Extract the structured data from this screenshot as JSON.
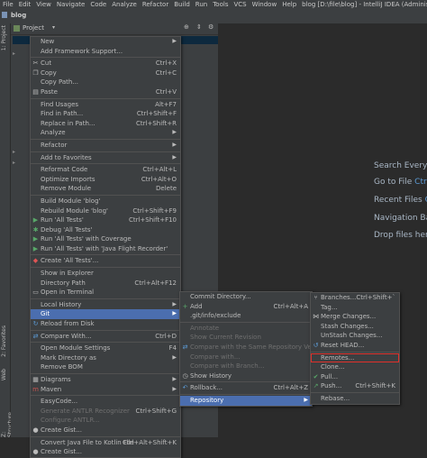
{
  "menubar": [
    "File",
    "Edit",
    "View",
    "Navigate",
    "Code",
    "Analyze",
    "Refactor",
    "Build",
    "Run",
    "Tools",
    "VCS",
    "Window",
    "Help",
    "blog [D:\\file\\blog] - IntelliJ IDEA (Administrator)"
  ],
  "breadcrumb": "blog",
  "project_panel": {
    "title": "Project"
  },
  "side_tabs": {
    "project": "1: Project",
    "favorites": "2: Favorites",
    "web": "Web",
    "structure": "Z: Structure"
  },
  "editor_hints": [
    {
      "label": "Search Everywh",
      "key": ""
    },
    {
      "label": "Go to File ",
      "key": "Ctrl+"
    },
    {
      "label": "Recent Files ",
      "key": "Ct"
    },
    {
      "label": "Navigation Bar ",
      "key": ""
    },
    {
      "label": "Drop files here",
      "key": ""
    }
  ],
  "context_menu": [
    {
      "label": "New",
      "arrow": true
    },
    {
      "label": "Add Framework Support..."
    },
    {
      "sep": true
    },
    {
      "label": "Cut",
      "shortcut": "Ctrl+X",
      "icon": "cut-icon"
    },
    {
      "label": "Copy",
      "shortcut": "Ctrl+C",
      "icon": "copy-icon"
    },
    {
      "label": "Copy Path..."
    },
    {
      "label": "Paste",
      "shortcut": "Ctrl+V",
      "icon": "paste-icon"
    },
    {
      "sep": true
    },
    {
      "label": "Find Usages",
      "shortcut": "Alt+F7"
    },
    {
      "label": "Find in Path...",
      "shortcut": "Ctrl+Shift+F"
    },
    {
      "label": "Replace in Path...",
      "shortcut": "Ctrl+Shift+R"
    },
    {
      "label": "Analyze",
      "arrow": true
    },
    {
      "sep": true
    },
    {
      "label": "Refactor",
      "arrow": true
    },
    {
      "sep": true
    },
    {
      "label": "Add to Favorites",
      "arrow": true
    },
    {
      "sep": true
    },
    {
      "label": "Reformat Code",
      "shortcut": "Ctrl+Alt+L"
    },
    {
      "label": "Optimize Imports",
      "shortcut": "Ctrl+Alt+O"
    },
    {
      "label": "Remove Module",
      "shortcut": "Delete"
    },
    {
      "sep": true
    },
    {
      "label": "Build Module 'blog'"
    },
    {
      "label": "Rebuild Module 'blog'",
      "shortcut": "Ctrl+Shift+F9"
    },
    {
      "label": "Run 'All Tests'",
      "shortcut": "Ctrl+Shift+F10",
      "icon": "run-icon"
    },
    {
      "label": "Debug 'All Tests'",
      "icon": "debug-icon"
    },
    {
      "label": "Run 'All Tests' with Coverage",
      "icon": "coverage-icon"
    },
    {
      "label": "Run 'All Tests' with 'Java Flight Recorder'",
      "icon": "profiler-icon"
    },
    {
      "sep": true
    },
    {
      "label": "Create 'All Tests'...",
      "icon": "test-icon"
    },
    {
      "sep": true
    },
    {
      "label": "Show in Explorer"
    },
    {
      "label": "Directory Path",
      "shortcut": "Ctrl+Alt+F12"
    },
    {
      "label": "Open in Terminal",
      "icon": "terminal-icon"
    },
    {
      "sep": true
    },
    {
      "label": "Local History",
      "arrow": true
    },
    {
      "label": "Git",
      "arrow": true,
      "selected": true
    },
    {
      "label": "Reload from Disk",
      "icon": "reload-icon"
    },
    {
      "sep": true
    },
    {
      "label": "Compare With...",
      "shortcut": "Ctrl+D",
      "icon": "compare-icon"
    },
    {
      "sep": true
    },
    {
      "label": "Open Module Settings",
      "shortcut": "F4"
    },
    {
      "label": "Mark Directory as",
      "arrow": true
    },
    {
      "label": "Remove BOM"
    },
    {
      "sep": true
    },
    {
      "label": "Diagrams",
      "arrow": true,
      "icon": "diagram-icon"
    },
    {
      "label": "Maven",
      "arrow": true,
      "icon": "maven-icon"
    },
    {
      "sep": true
    },
    {
      "label": "EasyCode..."
    },
    {
      "label": "Generate ANTLR Recognizer",
      "shortcut": "Ctrl+Shift+G",
      "disabled": true
    },
    {
      "label": "Configure ANTLR...",
      "disabled": true
    },
    {
      "label": "Create Gist...",
      "icon": "github-icon"
    },
    {
      "sep": true
    },
    {
      "label": "Convert Java File to Kotlin File",
      "shortcut": "Ctrl+Alt+Shift+K"
    },
    {
      "label": "Create Gist...",
      "icon": "github-icon"
    }
  ],
  "git_menu": [
    {
      "label": "Commit Directory..."
    },
    {
      "label": "Add",
      "shortcut": "Ctrl+Alt+A",
      "icon": "add-icon"
    },
    {
      "label": ".git/info/exclude"
    },
    {
      "sep": true
    },
    {
      "label": "Annotate",
      "disabled": true
    },
    {
      "label": "Show Current Revision",
      "disabled": true
    },
    {
      "label": "Compare with the Same Repository Version",
      "disabled": true,
      "icon": "compare-icon"
    },
    {
      "label": "Compare with...",
      "disabled": true
    },
    {
      "label": "Compare with Branch...",
      "disabled": true
    },
    {
      "label": "Show History",
      "icon": "history-icon"
    },
    {
      "sep": true
    },
    {
      "label": "Rollback...",
      "shortcut": "Ctrl+Alt+Z",
      "icon": "rollback-icon"
    },
    {
      "sep": true
    },
    {
      "label": "Repository",
      "arrow": true,
      "selected": true
    }
  ],
  "repository_menu": [
    {
      "label": "Branches...",
      "shortcut": "Ctrl+Shift+`",
      "icon": "branch-icon"
    },
    {
      "label": "Tag..."
    },
    {
      "label": "Merge Changes...",
      "icon": "merge-icon"
    },
    {
      "label": "Stash Changes..."
    },
    {
      "label": "UnStash Changes..."
    },
    {
      "label": "Reset HEAD...",
      "icon": "reset-icon"
    },
    {
      "sep": true
    },
    {
      "label": "Remotes...",
      "highlighted": true
    },
    {
      "label": "Clone..."
    },
    {
      "label": "Pull...",
      "icon": "pull-icon"
    },
    {
      "label": "Push...",
      "shortcut": "Ctrl+Shift+K",
      "icon": "push-icon"
    },
    {
      "sep": true
    },
    {
      "label": "Rebase..."
    }
  ]
}
